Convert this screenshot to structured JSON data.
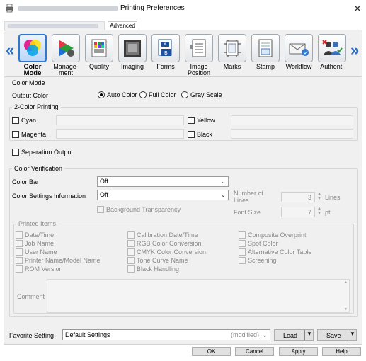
{
  "window": {
    "title": "Printing Preferences",
    "close_label": "✕"
  },
  "tabs": {
    "advanced": "Advanced"
  },
  "categories": [
    {
      "label": "Color Mode",
      "icon": "color-mode-icon",
      "active": true
    },
    {
      "label": "Manage-\nment",
      "icon": "management-icon"
    },
    {
      "label": "Quality",
      "icon": "quality-icon"
    },
    {
      "label": "Imaging",
      "icon": "imaging-icon"
    },
    {
      "label": "Forms",
      "icon": "forms-icon"
    },
    {
      "label": "Image\nPosition",
      "icon": "image-position-icon"
    },
    {
      "label": "Marks",
      "icon": "marks-icon"
    },
    {
      "label": "Stamp",
      "icon": "stamp-icon"
    },
    {
      "label": "Workflow",
      "icon": "workflow-icon"
    },
    {
      "label": "Authent.",
      "icon": "authentication-icon"
    }
  ],
  "nav": {
    "left": "«",
    "right": "»"
  },
  "color_mode": {
    "section_title": "Color Mode",
    "output_color_label": "Output Color",
    "options": [
      "Auto Color",
      "Full Color",
      "Gray Scale"
    ],
    "selected": "Auto Color"
  },
  "two_color": {
    "title": "2-Color Printing",
    "cyan": "Cyan",
    "magenta": "Magenta",
    "yellow": "Yellow",
    "black": "Black"
  },
  "separation_output": "Separation Output",
  "color_verification": {
    "title": "Color Verification",
    "color_bar_label": "Color Bar",
    "color_bar_value": "Off",
    "settings_info_label": "Color Settings Information",
    "settings_info_value": "Off",
    "number_of_lines_label": "Number of\nLines",
    "number_of_lines_value": "3",
    "number_of_lines_unit": "Lines",
    "font_size_label": "Font Size",
    "font_size_value": "7",
    "font_size_unit": "pt",
    "background_transparency": "Background Transparency"
  },
  "printed_items": {
    "title": "Printed Items",
    "col1": [
      "Date/Time",
      "Job Name",
      "User Name",
      "Printer Name/Model Name",
      "ROM Version"
    ],
    "col2": [
      "Calibration Date/Time",
      "RGB Color Conversion",
      "CMYK Color Conversion",
      "Tone Curve Name",
      "Black Handling"
    ],
    "col3": [
      "Composite Overprint",
      "Spot Color",
      "Alternative Color Table",
      "Screening"
    ],
    "comment_label": "Comment"
  },
  "favorite": {
    "label": "Favorite Setting",
    "value": "Default Settings",
    "modified": "(modified)",
    "load": "Load",
    "save": "Save"
  },
  "buttons": {
    "ok": "OK",
    "cancel": "Cancel",
    "apply": "Apply",
    "help": "Help"
  },
  "colors": {
    "accent": "#2f78d0",
    "nav_arrow": "#2a6fc0"
  }
}
